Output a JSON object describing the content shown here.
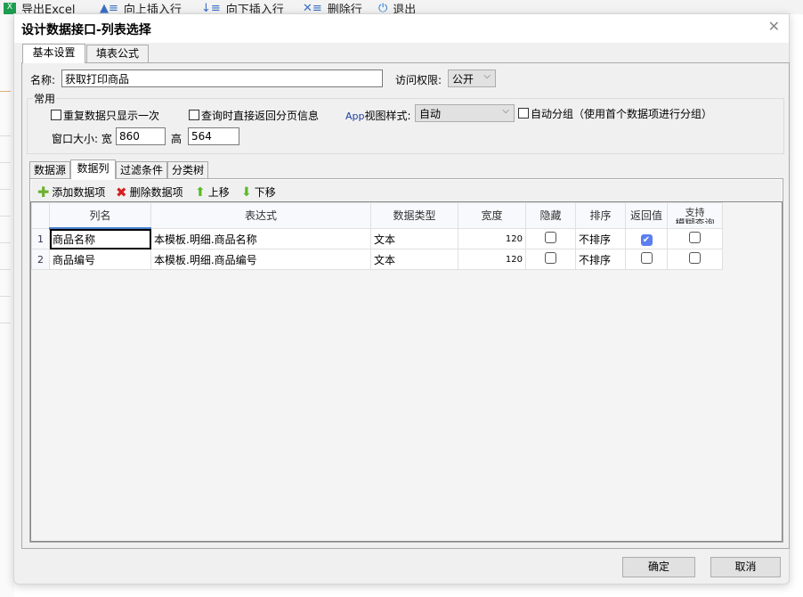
{
  "app_toolbar": {
    "items": [
      {
        "label": "导出Excel",
        "icon": "excel-icon"
      },
      {
        "label": "向上插入行",
        "icon": "insert-row-above-icon"
      },
      {
        "label": "向下插入行",
        "icon": "insert-row-below-icon"
      },
      {
        "label": "删除行",
        "icon": "delete-row-icon"
      },
      {
        "label": "退出",
        "icon": "power-icon"
      }
    ]
  },
  "dialog": {
    "title": "设计数据接口-列表选择",
    "close": "✕"
  },
  "tabs": [
    "基本设置",
    "填表公式"
  ],
  "basic": {
    "name_label": "名称:",
    "name_value": "获取打印商品",
    "access_label": "访问权限:",
    "access_value": "公开",
    "group_title": "常用",
    "repeat_once": "重复数据只显示一次",
    "repeat_once_checked": false,
    "return_paging": "查询时直接返回分页信息",
    "return_paging_checked": false,
    "app_view_label_a": "App",
    "app_view_label_b": "视图样式:",
    "app_view_value": "自动",
    "auto_group": "自动分组（使用首个数据项进行分组）",
    "auto_group_checked": false,
    "window_size_label": "窗口大小: 宽",
    "width_value": "860",
    "height_label": "高",
    "height_value": "564"
  },
  "sub_tabs": [
    "数据源",
    "数据列",
    "过滤条件",
    "分类树"
  ],
  "grid_toolbar": {
    "add": "添加数据项",
    "delete": "删除数据项",
    "up": "上移",
    "down": "下移"
  },
  "grid": {
    "headers": [
      "列名",
      "表达式",
      "数据类型",
      "宽度",
      "隐藏",
      "排序",
      "返回值",
      "支持\n模糊查询"
    ],
    "header_fuzzy_a": "支持",
    "header_fuzzy_b": "模糊查询",
    "rows": [
      {
        "num": "1",
        "name": "商品名称",
        "expr": "本模板.明细.商品名称",
        "type": "文本",
        "width": "120",
        "hidden": false,
        "sort": "不排序",
        "return": true,
        "fuzzy": false
      },
      {
        "num": "2",
        "name": "商品编号",
        "expr": "本模板.明细.商品编号",
        "type": "文本",
        "width": "120",
        "hidden": false,
        "sort": "不排序",
        "return": false,
        "fuzzy": false
      }
    ]
  },
  "buttons": {
    "ok": "确定",
    "cancel": "取消"
  }
}
